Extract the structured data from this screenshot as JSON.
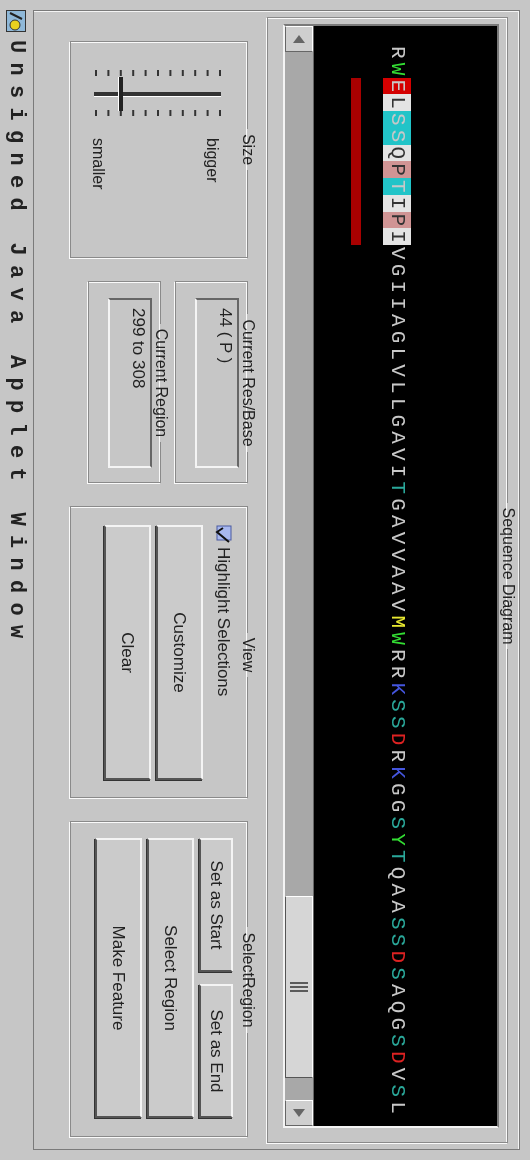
{
  "sequence_diagram": {
    "title": "Sequence Diagram",
    "segments": [
      {
        "kind": "plain",
        "residues": [
          {
            "letter": "R",
            "color": "#c8c8c8"
          },
          {
            "letter": "W",
            "color": "#33dd33"
          }
        ]
      },
      {
        "kind": "selected",
        "residues": [
          {
            "letter": "E",
            "color": "#d40000"
          },
          {
            "letter": "L",
            "color": "#e4e4e4"
          },
          {
            "letter": "S",
            "color": "#22c4c8"
          },
          {
            "letter": "S",
            "color": "#22c4c8"
          },
          {
            "letter": "Q",
            "color": "#e4e4e4"
          },
          {
            "letter": "P",
            "color": "#d09494"
          },
          {
            "letter": "T",
            "color": "#22c4c8"
          },
          {
            "letter": "I",
            "color": "#e4e4e4"
          },
          {
            "letter": "P",
            "color": "#d09494"
          },
          {
            "letter": "I",
            "color": "#e4e4e4"
          }
        ]
      },
      {
        "kind": "plain",
        "residues": [
          {
            "letter": "V",
            "color": "#c8c8c8"
          },
          {
            "letter": "G",
            "color": "#c8c8c8"
          },
          {
            "letter": "I",
            "color": "#c8c8c8"
          },
          {
            "letter": "I",
            "color": "#c8c8c8"
          },
          {
            "letter": "A",
            "color": "#c8c8c8"
          },
          {
            "letter": "G",
            "color": "#c8c8c8"
          },
          {
            "letter": "L",
            "color": "#c8c8c8"
          },
          {
            "letter": "V",
            "color": "#c8c8c8"
          },
          {
            "letter": "L",
            "color": "#c8c8c8"
          },
          {
            "letter": "L",
            "color": "#c8c8c8"
          },
          {
            "letter": "G",
            "color": "#c8c8c8"
          },
          {
            "letter": "A",
            "color": "#c8c8c8"
          },
          {
            "letter": "V",
            "color": "#c8c8c8"
          },
          {
            "letter": "I",
            "color": "#c8c8c8"
          },
          {
            "letter": "T",
            "color": "#2aa89a"
          },
          {
            "letter": "G",
            "color": "#c8c8c8"
          },
          {
            "letter": "A",
            "color": "#c8c8c8"
          },
          {
            "letter": "V",
            "color": "#c8c8c8"
          },
          {
            "letter": "V",
            "color": "#c8c8c8"
          },
          {
            "letter": "A",
            "color": "#c8c8c8"
          },
          {
            "letter": "A",
            "color": "#c8c8c8"
          },
          {
            "letter": "V",
            "color": "#c8c8c8"
          },
          {
            "letter": "M",
            "color": "#e8e830"
          },
          {
            "letter": "W",
            "color": "#33dd33"
          },
          {
            "letter": "R",
            "color": "#c8c8c8"
          },
          {
            "letter": "R",
            "color": "#c8c8c8"
          },
          {
            "letter": "K",
            "color": "#4455dd"
          },
          {
            "letter": "S",
            "color": "#2aa89a"
          },
          {
            "letter": "S",
            "color": "#2aa89a"
          },
          {
            "letter": "D",
            "color": "#dd2222"
          },
          {
            "letter": "R",
            "color": "#c8c8c8"
          },
          {
            "letter": "K",
            "color": "#4455dd"
          },
          {
            "letter": "G",
            "color": "#c8c8c8"
          },
          {
            "letter": "G",
            "color": "#c8c8c8"
          },
          {
            "letter": "S",
            "color": "#2aa89a"
          },
          {
            "letter": "Y",
            "color": "#33dd33"
          },
          {
            "letter": "T",
            "color": "#2aa89a"
          },
          {
            "letter": "Q",
            "color": "#c8c8c8"
          },
          {
            "letter": "A",
            "color": "#c8c8c8"
          },
          {
            "letter": "A",
            "color": "#c8c8c8"
          },
          {
            "letter": "S",
            "color": "#2aa89a"
          },
          {
            "letter": "S",
            "color": "#2aa89a"
          },
          {
            "letter": "D",
            "color": "#dd2222"
          },
          {
            "letter": "S",
            "color": "#2aa89a"
          },
          {
            "letter": "A",
            "color": "#c8c8c8"
          },
          {
            "letter": "Q",
            "color": "#c8c8c8"
          },
          {
            "letter": "G",
            "color": "#c8c8c8"
          },
          {
            "letter": "S",
            "color": "#2aa89a"
          },
          {
            "letter": "D",
            "color": "#dd2222"
          },
          {
            "letter": "V",
            "color": "#c8c8c8"
          },
          {
            "letter": "S",
            "color": "#2aa89a"
          },
          {
            "letter": "L",
            "color": "#c8c8c8"
          }
        ]
      }
    ]
  },
  "size": {
    "title": "Size",
    "slider": {
      "level": 0.2
    },
    "max_label": "bigger",
    "min_label": "smaller"
  },
  "current_res_base": {
    "title": "Current Res/Base",
    "value": "44 ( P )"
  },
  "current_region": {
    "title": "Current Region",
    "value": "299 to 308"
  },
  "view": {
    "title": "View",
    "highlight_selections": {
      "label": "Highlight Selections",
      "checked": true
    },
    "buttons": [
      "Customize",
      "Clear"
    ]
  },
  "select_region": {
    "title": "SelectRegion",
    "button_rows": [
      [
        "Set as Start",
        "Set as End"
      ],
      [
        "Select Region"
      ],
      [
        "Make Feature"
      ]
    ]
  },
  "status_bar": "Unsigned Java Applet Window"
}
